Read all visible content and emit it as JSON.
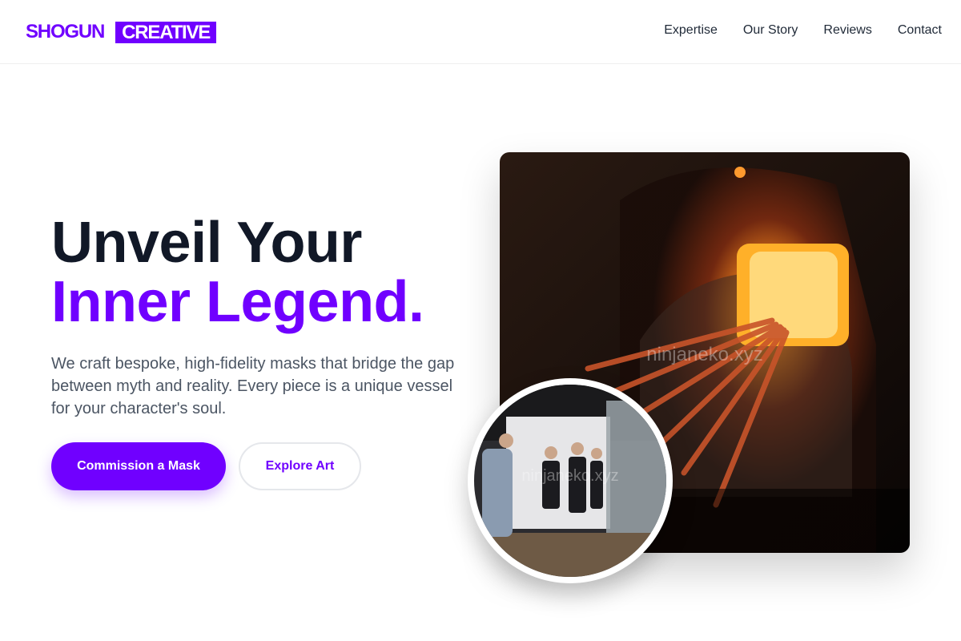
{
  "brand": {
    "name_part1": "SHOGUN",
    "name_part2": "CREATIVE"
  },
  "nav": {
    "items": [
      "Expertise",
      "Our Story",
      "Reviews",
      "Contact"
    ]
  },
  "hero": {
    "headline_line1": "Unveil Your",
    "headline_line2": "Inner Legend.",
    "description": "We craft bespoke, high-fidelity masks that bridge the gap between myth and reality. Every piece is a unique vessel for your character's soul.",
    "primary_cta": "Commission a Mask",
    "secondary_cta": "Explore Art"
  },
  "images": {
    "main_watermark": "ninjaneko.xyz",
    "round_watermark": "ninjaneko.xyz"
  },
  "colors": {
    "accent": "#7000ff",
    "heading": "#111827",
    "body_text": "#4b5563"
  }
}
